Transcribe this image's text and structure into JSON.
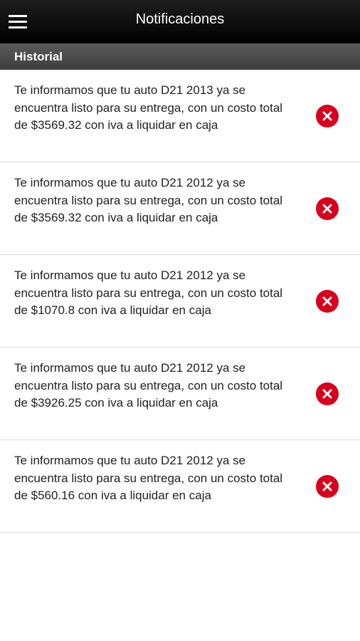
{
  "header": {
    "title": "Notificaciones",
    "menu_icon": "hamburger-menu-icon"
  },
  "section": {
    "title": "Historial"
  },
  "notifications": [
    {
      "text": "Te informamos que tu auto D21 2013 ya se encuentra listo para su entrega, con un costo total de $3569.32 con iva a liquidar en caja"
    },
    {
      "text": "Te informamos que tu auto D21 2012 ya se encuentra listo para su entrega, con un costo total de $3569.32 con iva a liquidar en caja"
    },
    {
      "text": "Te informamos que tu auto D21 2012 ya se encuentra listo para su entrega, con un costo total de $1070.8 con iva a liquidar en caja"
    },
    {
      "text": "Te informamos que tu auto D21 2012 ya se encuentra listo para su entrega, con un costo total de $3926.25 con iva a liquidar en caja"
    },
    {
      "text": "Te informamos que tu auto D21 2012 ya se encuentra listo para su entrega, con un costo total de $560.16 con iva a liquidar en caja"
    }
  ],
  "colors": {
    "header_bg": "#000000",
    "section_bg": "#4a4a4a",
    "delete_accent": "#d8001c"
  }
}
